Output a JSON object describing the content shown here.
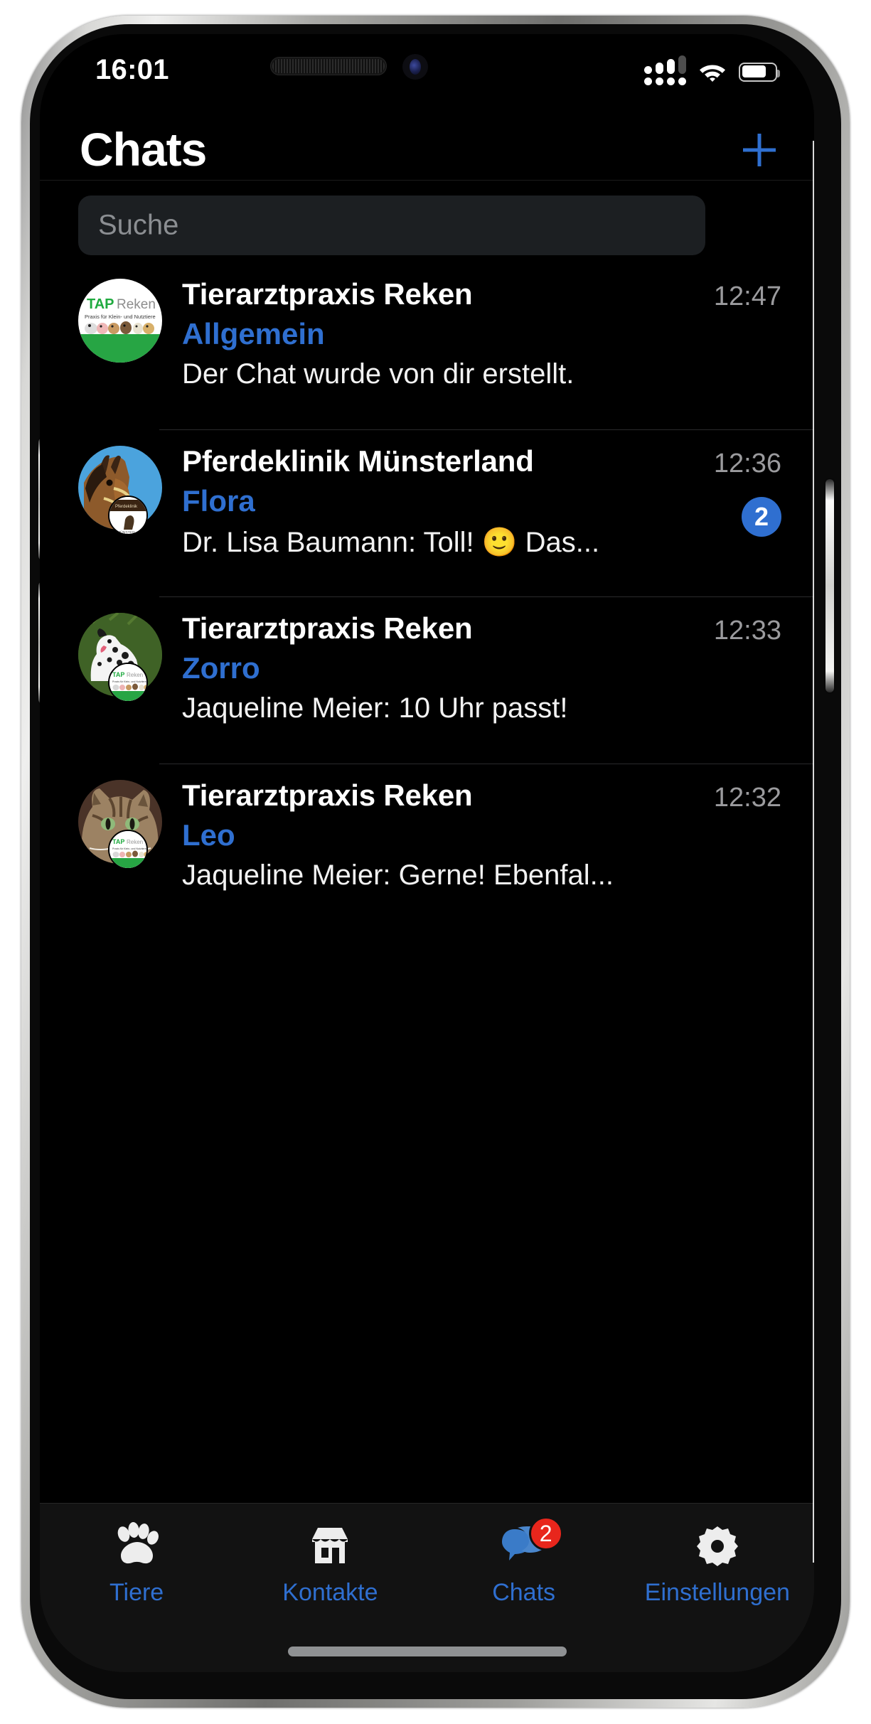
{
  "status_bar": {
    "time": "16:01",
    "signal_icon": "cellular-dual-sim-icon",
    "wifi_icon": "wifi-icon",
    "battery_icon": "battery-icon",
    "battery_level_percent": 70
  },
  "header": {
    "title": "Chats",
    "compose_icon": "plus-icon",
    "accent_color": "#2f6fd0"
  },
  "search": {
    "placeholder": "Suche",
    "value": "",
    "icon": "search-icon"
  },
  "chats": [
    {
      "avatar_name": "tierarztpraxis-reken-logo-avatar",
      "title": "Tierarztpraxis Reken",
      "subject": "Allgemein",
      "preview": "Der Chat wurde von dir erstellt.",
      "time": "12:47",
      "unread": null,
      "has_badge_overlay": false
    },
    {
      "avatar_name": "horse-photo-avatar",
      "title": "Pferdeklinik Münsterland",
      "subject": "Flora",
      "preview": "Dr. Lisa Baumann: Toll! 🙂 Das...",
      "time": "12:36",
      "unread": "2",
      "has_badge_overlay": true
    },
    {
      "avatar_name": "dalmatian-dog-photo-avatar",
      "title": "Tierarztpraxis Reken",
      "subject": "Zorro",
      "preview": "Jaqueline Meier: 10 Uhr passt!",
      "time": "12:33",
      "unread": null,
      "has_badge_overlay": true
    },
    {
      "avatar_name": "tabby-cat-photo-avatar",
      "title": "Tierarztpraxis Reken",
      "subject": "Leo",
      "preview": "Jaqueline Meier: Gerne! Ebenfal...",
      "time": "12:32",
      "unread": null,
      "has_badge_overlay": true
    }
  ],
  "tab_bar": {
    "items": [
      {
        "label": "Tiere",
        "icon": "paw-icon",
        "badge": null,
        "active": false
      },
      {
        "label": "Kontakte",
        "icon": "store-icon",
        "badge": null,
        "active": false
      },
      {
        "label": "Chats",
        "icon": "chat-bubbles-icon",
        "badge": "2",
        "active": true
      },
      {
        "label": "Einstellungen",
        "icon": "gear-icon",
        "badge": null,
        "active": false
      }
    ]
  },
  "avatar_logo": {
    "line1_tap": "TAP",
    "line1_reken": "Reken",
    "line2": "Praxis für Klein- und Nutztiere"
  }
}
